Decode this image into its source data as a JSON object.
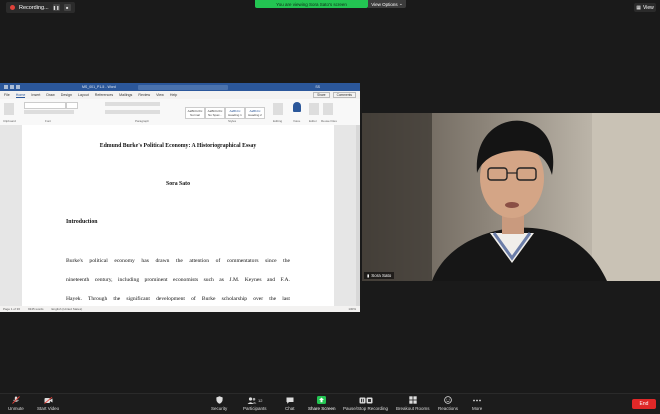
{
  "top_bar": {
    "recording_label": "Recording...",
    "share_banner": "You are viewing Sora Sato's screen",
    "view_options": "View Options",
    "view_button": "View"
  },
  "word": {
    "filename": "MS_001_P1-5 - Word",
    "user_initials": "SS",
    "tabs": [
      "File",
      "Home",
      "Insert",
      "Draw",
      "Design",
      "Layout",
      "References",
      "Mailings",
      "Review",
      "View",
      "Help"
    ],
    "share_label": "Share",
    "comments_label": "Comments",
    "styles": [
      "Normal",
      "No Spac...",
      "Heading 1",
      "Heading 2"
    ],
    "groups": [
      "Clipboard",
      "Font",
      "Paragraph",
      "Styles",
      "Editing",
      "Voice",
      "Editor",
      "Reuse Files"
    ],
    "document": {
      "title": "Edmund Burke's Political Economy: A Historiographical Essay",
      "author": "Sora Sato",
      "heading": "Introduction",
      "lines": [
        "Burke's political economy has drawn the attention of commentators since the",
        "nineteenth century, including prominent economists such as J.M. Keynes and F.A.",
        "Hayek. Through the significant development of Burke scholarship over the last"
      ]
    },
    "status": {
      "page": "Page 1 of 36",
      "words": "9345 words",
      "language": "English (United States)",
      "zoom": "130%"
    }
  },
  "camera": {
    "participant_name": "Sora Sato"
  },
  "toolbar": {
    "unmute": "Unmute",
    "start_video": "Start Video",
    "security": "Security",
    "participants": "Participants",
    "participants_count": "12",
    "chat": "Chat",
    "share_screen": "Share Screen",
    "pause_recording": "Pause/Stop Recording",
    "breakout_rooms": "Breakout Rooms",
    "reactions": "Reactions",
    "more": "More",
    "end": "End"
  },
  "colors": {
    "share_green": "#23c552",
    "word_blue": "#2b579a",
    "end_red": "#e02828"
  }
}
